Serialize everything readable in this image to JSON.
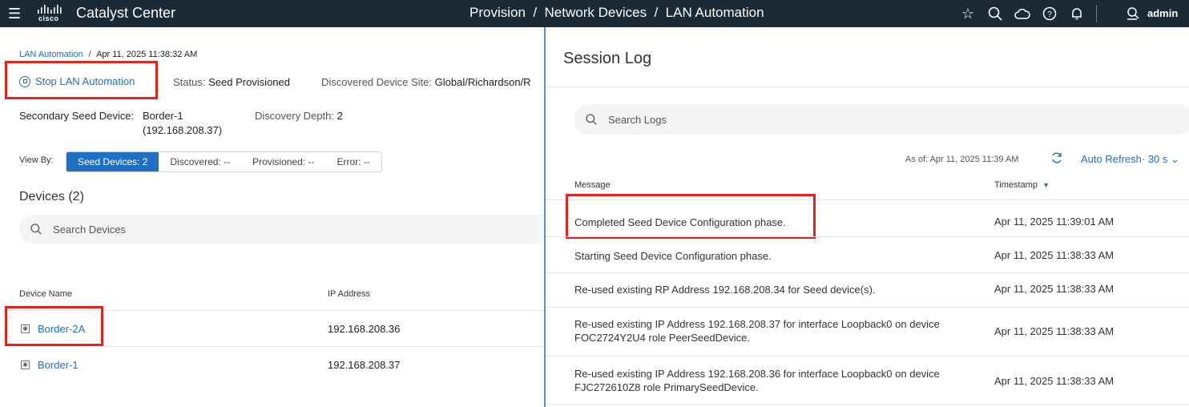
{
  "topbar": {
    "brand_word": "cisco",
    "app_name": "Catalyst Center",
    "breadcrumb": "Provision  /  Network Devices  /  LAN Automation",
    "user": "admin",
    "icons": [
      "star-icon",
      "search-icon",
      "cloud-icon",
      "help-icon",
      "bell-icon",
      "user-icon"
    ]
  },
  "left": {
    "breadcrumb_link": "LAN Automation",
    "breadcrumb_sep": "/",
    "breadcrumb_time": "Apr 11, 2025 11:38:32 AM",
    "stop_label": "Stop LAN Automation",
    "status_label": "Status:",
    "status_value": "Seed Provisioned",
    "site_label": "Discovered Device Site:",
    "site_value": "Global/Richardson/R",
    "secondary_label": "Secondary Seed Device:",
    "secondary_value": "Border-1",
    "secondary_ip": "(192.168.208.37)",
    "depth_label": "Discovery Depth:",
    "depth_value": "2",
    "viewby_label": "View By:",
    "tabs": [
      "Seed Devices: 2",
      "Discovered: --",
      "Provisioned: --",
      "Error: --"
    ],
    "devices_heading": "Devices (2)",
    "search_placeholder": "Search Devices",
    "columns": [
      "Device Name",
      "IP Address"
    ],
    "rows": [
      {
        "name": "Border-2A",
        "ip": "192.168.208.36"
      },
      {
        "name": "Border-1",
        "ip": "192.168.208.37"
      }
    ]
  },
  "right": {
    "title": "Session Log",
    "search_placeholder": "Search Logs",
    "as_of": "As of: Apr 11, 2025 11:39 AM",
    "auto_refresh": "Auto Refresh· 30 s",
    "col_message": "Message",
    "col_timestamp": "Timestamp",
    "logs": [
      {
        "message": "Completed Seed Device Configuration phase.",
        "timestamp": "Apr 11, 2025 11:39:01 AM"
      },
      {
        "message": "Starting Seed Device Configuration phase.",
        "timestamp": "Apr 11, 2025 11:38:33 AM"
      },
      {
        "message": "Re-used existing RP Address 192.168.208.34 for Seed device(s).",
        "timestamp": "Apr 11, 2025 11:38:33 AM"
      },
      {
        "message": "Re-used existing IP Address 192.168.208.37 for interface Loopback0 on device FOC2724Y2U4 role PeerSeedDevice.",
        "timestamp": "Apr 11, 2025 11:38:33 AM"
      },
      {
        "message": "Re-used existing IP Address 192.168.208.36 for interface Loopback0 on device FJC272610Z8 role PrimarySeedDevice.",
        "timestamp": "Apr 11, 2025 11:38:33 AM"
      }
    ]
  },
  "colors": {
    "topbar": "#1a2a36",
    "accent": "#1f6fc5",
    "highlight": "#e3241b"
  }
}
